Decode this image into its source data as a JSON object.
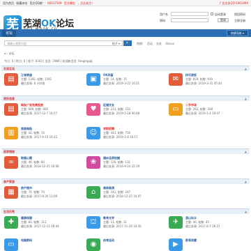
{
  "topbar": {
    "left_items": [
      "设为首页",
      "收藏本站",
      "官方QQ群：",
      "66137399",
      "官方微信",
      "，点击关注！"
    ],
    "right_text": "广告业务QQ:5061899"
  },
  "header": {
    "logo_char": "芜",
    "title_prefix": "芜湖",
    "title_ok": "OK",
    "title_suffix": "论坛",
    "domain": "bbs.whok.cn",
    "username_label": "用户名",
    "password_label": "密码",
    "autologin_label": "自动登录",
    "forgot_label": "找回密码",
    "login_label": "登录",
    "register_label": "立即注册"
  },
  "nav": {
    "tab_label": "论坛",
    "quick_label": "快捷导航 ▾"
  },
  "search": {
    "placeholder": "请输入搜索内容",
    "mode": "帖子 ▾",
    "button": "🔍",
    "hot_label": "热搜:",
    "hot_items": [
      "活动",
      "交友",
      "discuz"
    ]
  },
  "breadcrumb": "⌂ › 论坛",
  "stats": "今日: 0 | 昨日: 0 | 帖子: 6343 | 会员: 2984 | 欢迎新会员: fangmgqq",
  "sections": [
    {
      "title": "交流互动",
      "forums": [
        {
          "icon": "▤",
          "color": "#e25b3a",
          "name": "江城茶座",
          "name_red": false,
          "count": "主题: 1392, 帖数: 1591",
          "last": "最后发表: 8 小时前"
        },
        {
          "icon": "▣",
          "color": "#3a9ae8",
          "name": "OK间留",
          "name_red": false,
          "count": "主题: 14, 帖数: 15",
          "last": "最后发表: 2019-3-22 10:31"
        },
        {
          "icon": "✉",
          "color": "#e25b3a",
          "name": "拼天就饭",
          "name_red": false,
          "count": "主题: 859, 帖数: 919",
          "last": "最后发表: 2019-3-31 05:44"
        }
      ]
    },
    {
      "title": "便民信息",
      "forums": [
        {
          "icon": "▤",
          "color": "#e25b3a",
          "name": "网友广告免费投放",
          "name_red": true,
          "count": "主题: 649, 帖数: 665",
          "last": "最后发表: 2017-12-7 16:57"
        },
        {
          "icon": "♥",
          "color": "#e8588e",
          "name": "征婚交友",
          "name_red": false,
          "count": "主题: 222, 帖数: 232",
          "last": "最后发表: 2019-5-18 00:08"
        },
        {
          "icon": "▭",
          "color": "#f0a020",
          "name": "二手市场",
          "name_red": true,
          "count": "主题: 292, 帖数: 308",
          "last": "最后发表: 2019-1-4 19:47"
        }
      ]
    },
    {
      "title": "",
      "forums": [
        {
          "icon": "▥",
          "color": "#f0a020",
          "name": "美图每贴",
          "name_red": false,
          "count": "主题: 42, 帖数: 74",
          "last": "最后发表: 2017-9-15 16:42"
        },
        {
          "icon": "☺",
          "color": "#3a9ae8",
          "name": "求职招聘",
          "name_red": true,
          "count": "主题: 443, 帖数: 756",
          "last": "最后发表: 2019-1-8 16:17"
        }
      ]
    },
    {
      "title": "医家惜缘",
      "forums": [
        {
          "icon": "∞",
          "color": "#e25b3a",
          "name": "结婚心题",
          "name_red": false,
          "count": "主题: 46, 帖数: 60",
          "last": "最后发表: 2018-12-25 16:06"
        },
        {
          "icon": "❀",
          "color": "#d04aa0",
          "name": "婚纱品质拍摄",
          "name_red": false,
          "count": "主题: 126, 帖数: 131",
          "last": "最后发表: 2016-9-24 22:19"
        }
      ]
    },
    {
      "title": "房产家居",
      "forums": [
        {
          "icon": "▦",
          "color": "#e25b3a",
          "name": "房产楼市",
          "name_red": false,
          "count": "主题: 74, 帖数: 74",
          "last": "最后发表: 2017-9-20 11:09"
        },
        {
          "icon": "⌂",
          "color": "#3aaa55",
          "name": "装修装潢",
          "name_red": false,
          "count": "主题: 242, 帖数: 247",
          "last": "最后发表: 2018-12-25 16:07"
        }
      ]
    },
    {
      "title": "生活乐秀",
      "forums": [
        {
          "icon": "✚",
          "color": "#3aaa55",
          "name": "健康保健",
          "name_red": false,
          "count": "主题: 83, 帖数: 112",
          "last": "最后发表: 2017-12-11 09:44"
        },
        {
          "icon": "⛫",
          "color": "#3a9ae8",
          "name": "教育文学",
          "name_red": false,
          "count": "主题: 11, 帖数: 11",
          "last": "最后发表: 2017-11-26 10:56"
        },
        {
          "icon": "✈",
          "color": "#3aaa55",
          "name": "游山玩水",
          "name_red": false,
          "count": "主题: 40, 帖数: 45",
          "last": "最后发表: 2017-6-7 16:37"
        }
      ]
    },
    {
      "title": "",
      "forums": [
        {
          "icon": "▭",
          "color": "#3a9ae8",
          "name": "电脑数码",
          "name_red": false,
          "count": "",
          "last": ""
        },
        {
          "icon": "◉",
          "color": "#3aaa55",
          "name": "体育运动",
          "name_red": false,
          "count": "",
          "last": ""
        },
        {
          "icon": "▶",
          "color": "#3a9ae8",
          "name": "影视收藏",
          "name_red": false,
          "count": "",
          "last": ""
        }
      ]
    }
  ]
}
